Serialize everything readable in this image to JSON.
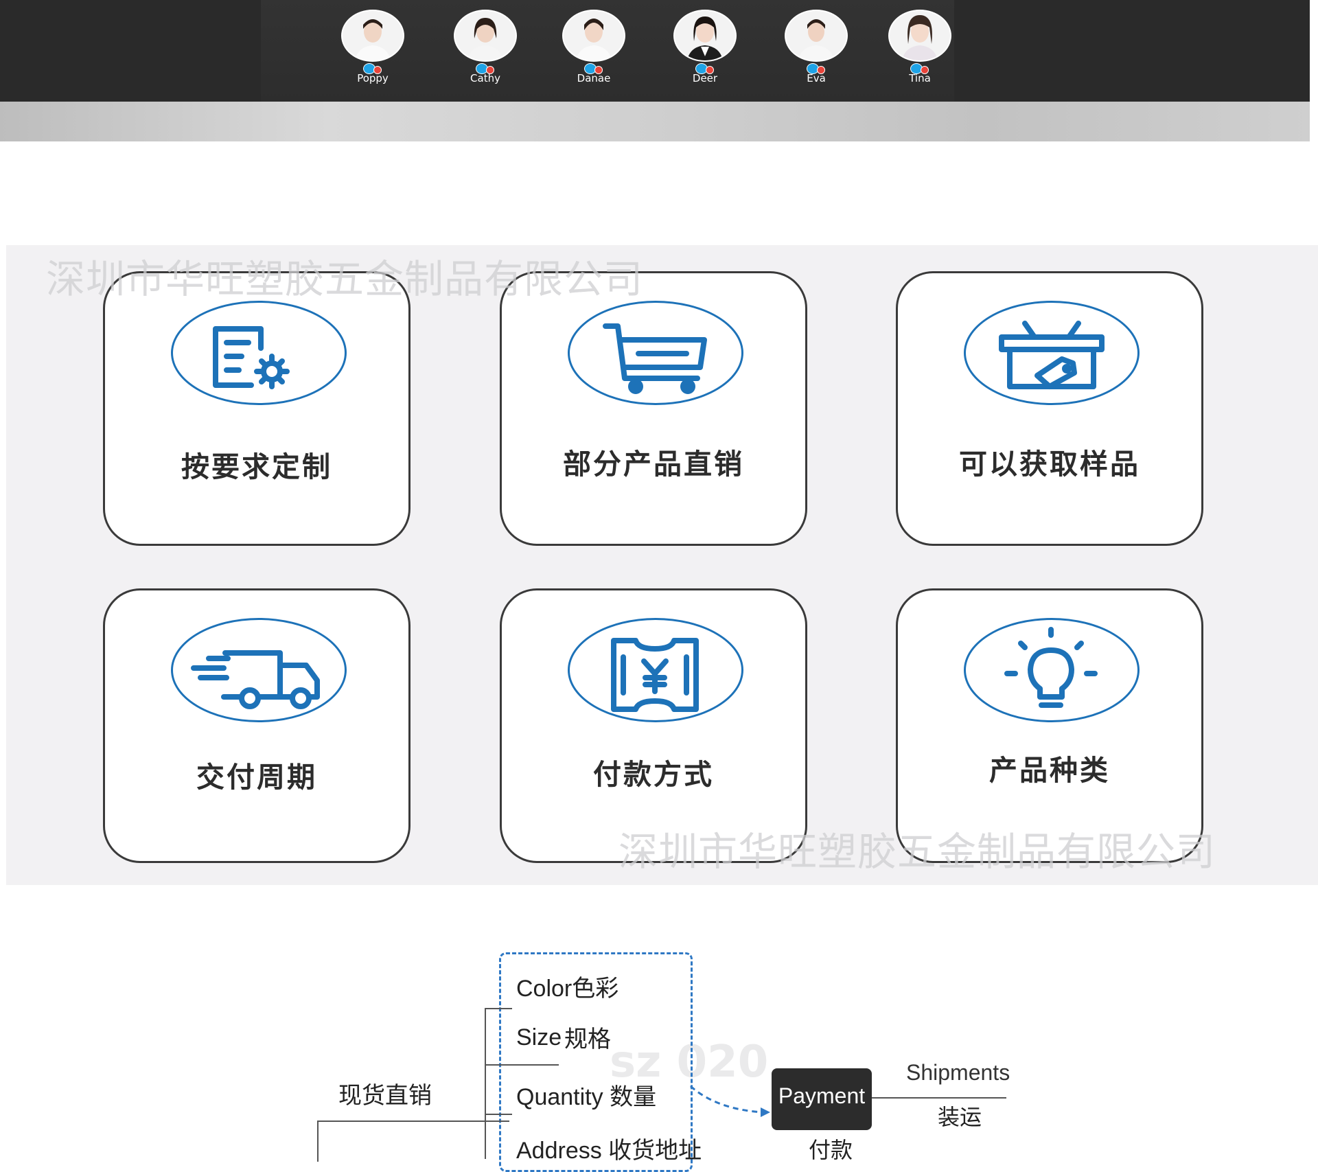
{
  "team": {
    "members": [
      {
        "name": "Poppy"
      },
      {
        "name": "Cathy"
      },
      {
        "name": "Danae"
      },
      {
        "name": "Deer"
      },
      {
        "name": "Eva"
      },
      {
        "name": "Tina"
      }
    ]
  },
  "services": {
    "watermark": "深圳市华旺塑胶五金制品有限公司",
    "cards": [
      {
        "label": "按要求定制",
        "icon": "document-gear-icon"
      },
      {
        "label": "部分产品直销",
        "icon": "shopping-cart-icon"
      },
      {
        "label": "可以获取样品",
        "icon": "basket-tag-icon"
      },
      {
        "label": "交付周期",
        "icon": "delivery-truck-icon"
      },
      {
        "label": "付款方式",
        "icon": "yen-ticket-icon"
      },
      {
        "label": "产品种类",
        "icon": "lightbulb-icon"
      }
    ],
    "accent_color": "#1d72b8"
  },
  "flow": {
    "spot_sale": "现货直销",
    "options": {
      "color": "Color色彩",
      "size_en": "Size",
      "size_cn": "规格",
      "quantity": "Quantity 数量",
      "address": "Address 收货地址"
    },
    "payment_en": "Payment",
    "payment_cn": "付款",
    "shipments_en": "Shipments",
    "shipments_cn": "装运",
    "watermark": "sz  020"
  }
}
